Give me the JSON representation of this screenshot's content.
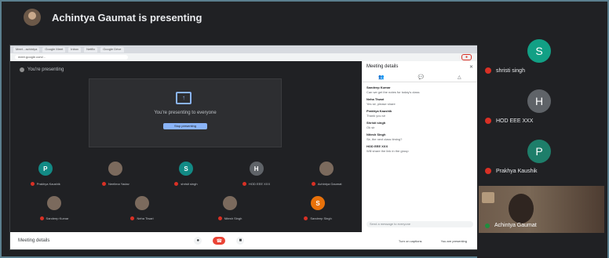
{
  "presenter": {
    "title": "Achintya Gaumat is presenting"
  },
  "shared": {
    "tabs": [
      "Meet - achintya",
      "Google Meet",
      "Inbox",
      "Netflix",
      "Google Drive"
    ],
    "url": "meet.google.com/...",
    "meet": {
      "presenting_label": "You're presenting",
      "stage_text": "You're presenting to everyone",
      "stage_button": "Stop presenting",
      "tiles_row1": [
        {
          "initial": "P",
          "name": "Prakhya Kaushik",
          "style": "teal"
        },
        {
          "initial": "",
          "name": "Neelima Yadav",
          "style": "photo"
        },
        {
          "initial": "S",
          "name": "shristi singh",
          "style": "teal"
        },
        {
          "initial": "H",
          "name": "HOD EEE XXX",
          "style": "gray"
        },
        {
          "initial": "",
          "name": "Achintya Gaumat",
          "style": "photo"
        }
      ],
      "tiles_row2": [
        {
          "initial": "",
          "name": "Sandeep Kumar",
          "style": "photo"
        },
        {
          "initial": "",
          "name": "Neha Tiwari",
          "style": "photo"
        },
        {
          "initial": "",
          "name": "Nitesh Singh",
          "style": "photo"
        },
        {
          "initial": "S",
          "name": "Sandeep Singh",
          "style": "orange"
        }
      ]
    },
    "bottom": {
      "meeting_details": "Meeting details",
      "actions": [
        "Turn on captions",
        "You are presenting"
      ]
    },
    "panel": {
      "title": "Meeting details",
      "close": "✕",
      "messages": [
        {
          "author": "Sandeep Kumar",
          "text": "Can we get the notes for today's class"
        },
        {
          "author": "Neha Tiwari",
          "text": "Yes sir, please share"
        },
        {
          "author": "Prakhya Kaushik",
          "text": "Thank you sir"
        },
        {
          "author": "Shristi singh",
          "text": "Ok sir"
        },
        {
          "author": "Nitesh Singh",
          "text": "Sir, the next class timing?"
        },
        {
          "author": "HOD EEE XXX",
          "text": "Will share the link in the group"
        }
      ],
      "input_placeholder": "Send a message to everyone"
    }
  },
  "side": {
    "participants": [
      {
        "initial": "S",
        "name": "shristi singh",
        "color": "#12a085"
      },
      {
        "initial": "H",
        "name": "HOD EEE XXX",
        "color": "#5f6368"
      },
      {
        "initial": "P",
        "name": "Prakhya Kaushik",
        "color": "#1e7e6a"
      }
    ],
    "video_name": "Achintya Gaumat"
  }
}
